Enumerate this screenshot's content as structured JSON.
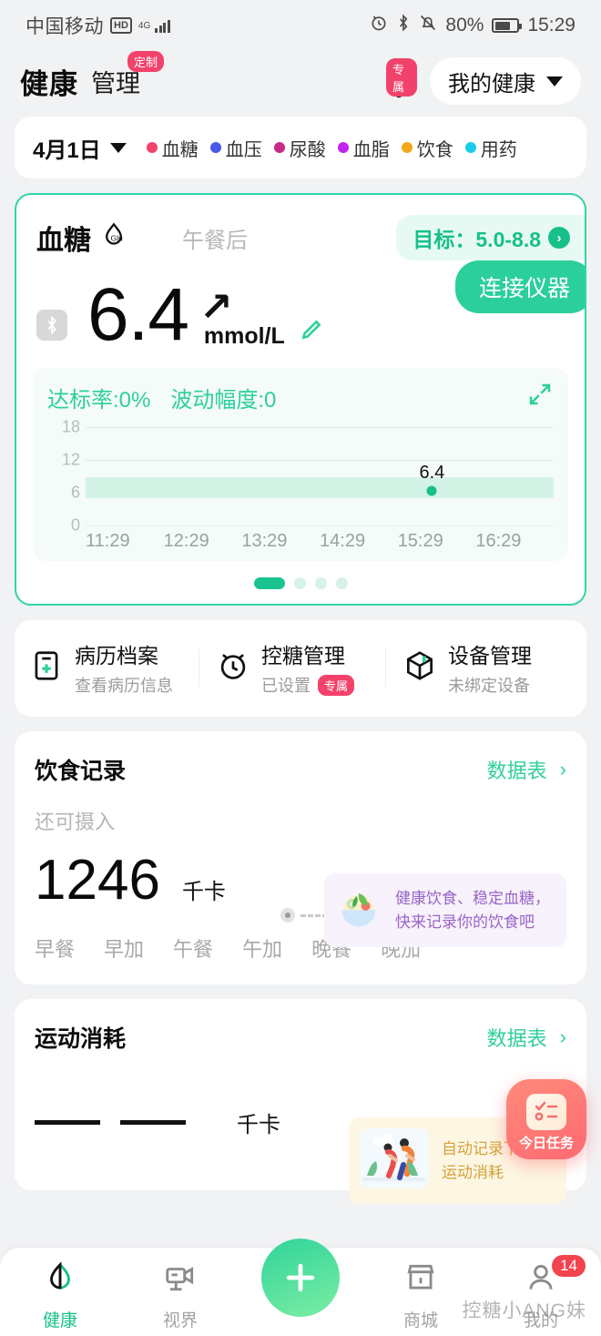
{
  "status_bar": {
    "carrier": "中国移动",
    "network_hd": "HD",
    "network_type": "4G",
    "battery_percent": "80%",
    "time": "15:29"
  },
  "header": {
    "title": "健康",
    "subtitle": "管理",
    "subtitle_badge": "定制",
    "bell_badge": "专属",
    "profile_select": "我的健康"
  },
  "legend_bar": {
    "date": "4月1日",
    "items": [
      {
        "label": "血糖",
        "color": "#f2426b"
      },
      {
        "label": "血压",
        "color": "#4a5ae8"
      },
      {
        "label": "尿酸",
        "color": "#c92a86"
      },
      {
        "label": "血脂",
        "color": "#c026f0"
      },
      {
        "label": "饮食",
        "color": "#f0a818"
      },
      {
        "label": "用药",
        "color": "#19cde8"
      }
    ]
  },
  "glucose_card": {
    "title": "血糖",
    "icon_label": "Glu",
    "meal_tag": "午餐后",
    "target_label": "目标：5.0-8.8",
    "value": "6.4",
    "trend": "↗",
    "unit": "mmol/L",
    "connect_button": "连接仪器",
    "stats": {
      "rate_label": "达标率:0%",
      "fluctuation_label": "波动幅度:0"
    },
    "pager": {
      "total": 4,
      "active": 1
    }
  },
  "chart_data": {
    "type": "scatter",
    "title": "血糖",
    "xlabel": "",
    "ylabel": "mmol/L",
    "x": [
      "11:29",
      "12:29",
      "13:29",
      "14:29",
      "15:29",
      "16:29"
    ],
    "yticks": [
      0,
      6,
      12,
      18
    ],
    "ylim": [
      0,
      18
    ],
    "grid": true,
    "legend": "none",
    "target_band": {
      "low": 5.0,
      "high": 8.8,
      "color": "#cdf1e3"
    },
    "series": [
      {
        "name": "血糖",
        "color": "#17c08a",
        "points": [
          {
            "x": "15:29",
            "y": 6.4,
            "label": "6.4"
          }
        ]
      }
    ]
  },
  "quick_actions": [
    {
      "title": "病历档案",
      "subtitle": "查看病历信息",
      "icon": "medical-record-icon",
      "badge": ""
    },
    {
      "title": "控糖管理",
      "subtitle": "已设置",
      "icon": "alarm-clock-icon",
      "badge": "专属"
    },
    {
      "title": "设备管理",
      "subtitle": "未绑定设备",
      "icon": "box-icon",
      "badge": ""
    }
  ],
  "diet_card": {
    "title": "饮食记录",
    "link": "数据表",
    "remaining_label": "还可摄入",
    "value": "1246",
    "unit": "千卡",
    "tip_line1": "健康饮食、稳定血糖，",
    "tip_line2": "快来记录你的饮食吧",
    "meals": [
      "早餐",
      "早加",
      "午餐",
      "午加",
      "晚餐",
      "晚加"
    ]
  },
  "exercise_card": {
    "title": "运动消耗",
    "link": "数据表",
    "value": "— —",
    "unit": "千卡",
    "tip_line1": "自动记录下您每",
    "tip_line2": "运动消耗"
  },
  "fab_task": {
    "label": "今日任务"
  },
  "bottom_nav": {
    "items": [
      {
        "label": "健康",
        "icon": "leaf-icon",
        "active": true,
        "badge": ""
      },
      {
        "label": "视界",
        "icon": "video-icon",
        "active": false,
        "badge": ""
      },
      {
        "label": "",
        "icon": "plus-icon",
        "active": false,
        "badge": ""
      },
      {
        "label": "商城",
        "icon": "shop-icon",
        "active": false,
        "badge": ""
      },
      {
        "label": "我的",
        "icon": "person-icon",
        "active": false,
        "badge": "14"
      }
    ]
  },
  "watermark": "控糖小ANG妹"
}
